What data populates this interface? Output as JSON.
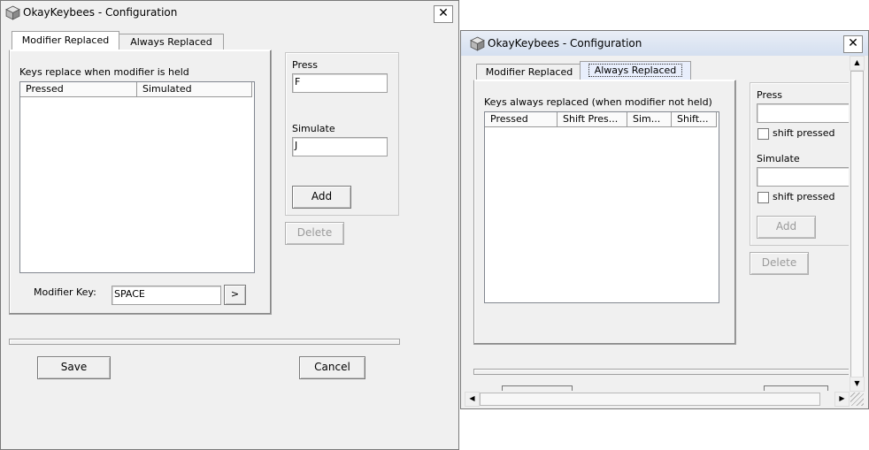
{
  "win1": {
    "title": "OkayKeybees - Configuration",
    "close_glyph": "✕",
    "tabs": [
      {
        "label": "Modifier Replaced"
      },
      {
        "label": "Always Replaced"
      }
    ],
    "group_label": "Keys replace when modifier is held",
    "columns": [
      "Pressed",
      "Simulated"
    ],
    "press_label": "Press",
    "press_value": "F",
    "simulate_label": "Simulate",
    "simulate_value": "J",
    "add_label": "Add",
    "delete_label": "Delete",
    "modifier_label": "Modifier Key:",
    "modifier_value": "SPACE",
    "modifier_btn": ">",
    "save_label": "Save",
    "cancel_label": "Cancel"
  },
  "win2": {
    "title": "OkayKeybees - Configuration",
    "close_glyph": "✕",
    "tabs": [
      {
        "label": "Modifier Replaced"
      },
      {
        "label": "Always Replaced"
      }
    ],
    "group_label": "Keys always replaced (when modifier not held)",
    "columns": [
      "Pressed",
      "Shift Pres...",
      "Sim...",
      "Shift..."
    ],
    "press_label": "Press",
    "shift_label": "shift pressed",
    "simulate_label": "Simulate",
    "shift_label2": "shift pressed",
    "add_label": "Add",
    "delete_label": "Delete",
    "arrows": {
      "up": "▲",
      "down": "▼",
      "left": "◀",
      "right": "▶"
    }
  },
  "colors": {
    "window_bg": "#f0f0f0",
    "title_active": "#d4dff0"
  },
  "icons": {
    "app": "cube-icon",
    "close": "close-icon"
  }
}
